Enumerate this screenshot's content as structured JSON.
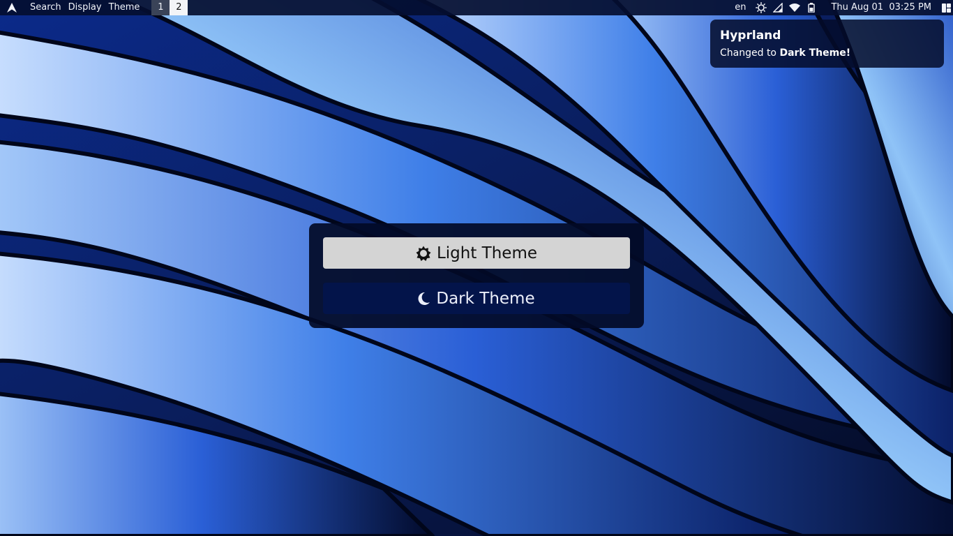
{
  "topbar": {
    "launcher_icon": "arch-linux-icon",
    "menus": [
      "Search",
      "Display",
      "Theme"
    ],
    "workspaces": [
      "1",
      "2"
    ],
    "active_workspace": "2",
    "language": "en",
    "tray_icons": [
      "brightness-icon",
      "cellular-signal-icon",
      "wifi-icon",
      "battery-icon"
    ],
    "clock": "Thu Aug 01  03:25 PM",
    "corner_icon": "window-layout-icon"
  },
  "notification": {
    "title": "Hyprland",
    "body_prefix": "Changed to ",
    "body_emphasis": "Dark Theme!"
  },
  "theme_menu": {
    "light_label": "Light Theme",
    "light_icon": "sun-icon",
    "dark_label": "Dark Theme",
    "dark_icon": "moon-icon"
  },
  "colors": {
    "bar_bg": "#040e30",
    "menu_bg": "#020a26",
    "light_button": "#d4d4d4",
    "dark_button": "#03144a"
  }
}
